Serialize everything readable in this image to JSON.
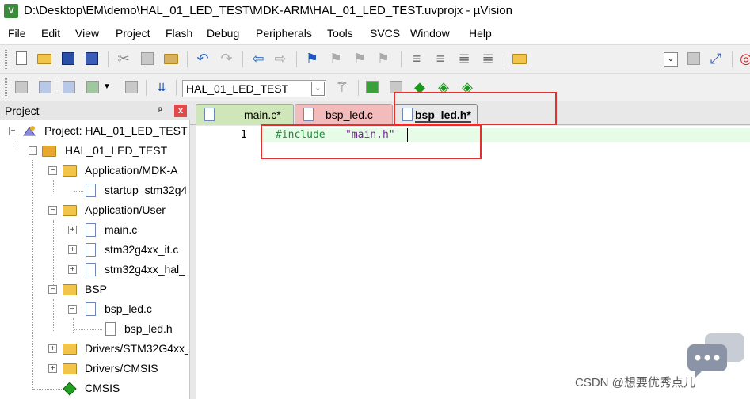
{
  "window": {
    "title": "D:\\Desktop\\EM\\demo\\HAL_01_LED_TEST\\MDK-ARM\\HAL_01_LED_TEST.uvprojx - µVision",
    "icon_text": "V"
  },
  "menu": [
    "File",
    "Edit",
    "View",
    "Project",
    "Flash",
    "Debug",
    "Peripherals",
    "Tools",
    "SVCS",
    "Window",
    "Help"
  ],
  "toolbar2": {
    "target_select": "HAL_01_LED_TEST"
  },
  "project_panel": {
    "title": "Project",
    "pin": "ᵖ",
    "close": "x",
    "tree": [
      {
        "label": "Project: HAL_01_LED_TEST",
        "kind": "project",
        "expander": "−"
      },
      {
        "label": "HAL_01_LED_TEST",
        "kind": "target",
        "expander": "−"
      },
      {
        "label": "Application/MDK-A",
        "kind": "folder",
        "expander": "−"
      },
      {
        "label": "startup_stm32g4",
        "kind": "file",
        "expander": ""
      },
      {
        "label": "Application/User",
        "kind": "folder",
        "expander": "−"
      },
      {
        "label": "main.c",
        "kind": "file",
        "expander": "+"
      },
      {
        "label": "stm32g4xx_it.c",
        "kind": "file",
        "expander": "+"
      },
      {
        "label": "stm32g4xx_hal_",
        "kind": "file",
        "expander": "+"
      },
      {
        "label": "BSP",
        "kind": "folder",
        "expander": "−"
      },
      {
        "label": "bsp_led.c",
        "kind": "file",
        "expander": "−"
      },
      {
        "label": "bsp_led.h",
        "kind": "file",
        "expander": ""
      },
      {
        "label": "Drivers/STM32G4xx_",
        "kind": "folder",
        "expander": "+"
      },
      {
        "label": "Drivers/CMSIS",
        "kind": "folder",
        "expander": "+"
      },
      {
        "label": "CMSIS",
        "kind": "component",
        "expander": ""
      }
    ]
  },
  "editor": {
    "tabs": [
      {
        "label": "main.c*",
        "color": "#cfe7b8"
      },
      {
        "label": "bsp_led.c",
        "color": "#f3bcbc"
      },
      {
        "label": "bsp_led.h*",
        "color": "#e8e8e8"
      }
    ],
    "line_number": "1",
    "code": {
      "directive": "#include",
      "space": " ",
      "string": "\"main.h\""
    }
  },
  "watermark": "CSDN @想要优秀点儿"
}
